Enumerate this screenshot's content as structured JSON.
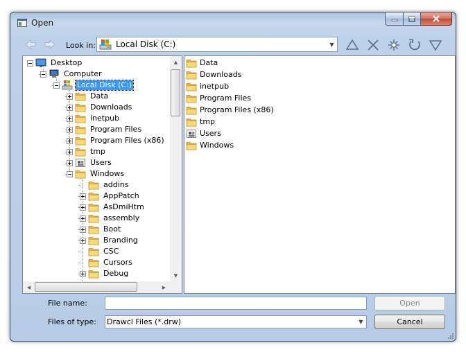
{
  "window": {
    "title": "Open"
  },
  "toolbar": {
    "look_in_label": "Look in:",
    "look_in_value": "Local Disk (C:)",
    "buttons": [
      "up-icon",
      "delete-icon",
      "new-folder-icon",
      "refresh-icon",
      "views-icon"
    ]
  },
  "tree": [
    {
      "label": "Desktop",
      "icon": "desktop-icon",
      "expander": "minus"
    },
    {
      "label": "Computer",
      "icon": "computer-icon",
      "expander": "minus"
    },
    {
      "label": "Local Disk (C:)",
      "icon": "drive-icon",
      "expander": "minus",
      "selected": true
    },
    {
      "label": "Data",
      "icon": "folder-icon",
      "expander": "plus"
    },
    {
      "label": "Downloads",
      "icon": "folder-icon",
      "expander": "plus"
    },
    {
      "label": "inetpub",
      "icon": "folder-icon",
      "expander": "plus"
    },
    {
      "label": "Program Files",
      "icon": "folder-icon",
      "expander": "plus"
    },
    {
      "label": "Program Files (x86)",
      "icon": "folder-icon",
      "expander": "plus"
    },
    {
      "label": "tmp",
      "icon": "folder-icon",
      "expander": "plus"
    },
    {
      "label": "Users",
      "icon": "users-folder-icon",
      "expander": "plus"
    },
    {
      "label": "Windows",
      "icon": "folder-icon",
      "expander": "minus"
    },
    {
      "label": "addins",
      "icon": "folder-icon",
      "expander": "none"
    },
    {
      "label": "AppPatch",
      "icon": "folder-icon",
      "expander": "plus"
    },
    {
      "label": "AsDmiHtm",
      "icon": "folder-icon",
      "expander": "plus"
    },
    {
      "label": "assembly",
      "icon": "folder-icon",
      "expander": "plus"
    },
    {
      "label": "Boot",
      "icon": "folder-icon",
      "expander": "plus"
    },
    {
      "label": "Branding",
      "icon": "folder-icon",
      "expander": "plus"
    },
    {
      "label": "CSC",
      "icon": "folder-icon",
      "expander": "none"
    },
    {
      "label": "Cursors",
      "icon": "folder-icon",
      "expander": "none"
    },
    {
      "label": "Debug",
      "icon": "folder-icon",
      "expander": "plus"
    }
  ],
  "files": [
    {
      "name": "Data",
      "icon": "folder-icon"
    },
    {
      "name": "Downloads",
      "icon": "folder-icon"
    },
    {
      "name": "inetpub",
      "icon": "folder-icon"
    },
    {
      "name": "Program Files",
      "icon": "folder-icon"
    },
    {
      "name": "Program Files (x86)",
      "icon": "folder-icon"
    },
    {
      "name": "tmp",
      "icon": "folder-icon"
    },
    {
      "name": "Users",
      "icon": "users-folder-icon"
    },
    {
      "name": "Windows",
      "icon": "folder-icon"
    }
  ],
  "bottom": {
    "file_name_label": "File name:",
    "file_name_value": "",
    "file_type_label": "Files of type:",
    "file_type_value": "Drawcl Files (*.drw)",
    "open_label": "Open",
    "cancel_label": "Cancel"
  },
  "colors": {
    "selection": "#3399ff",
    "folder": "#f5d36b",
    "chrome": "#bcd1ea"
  }
}
